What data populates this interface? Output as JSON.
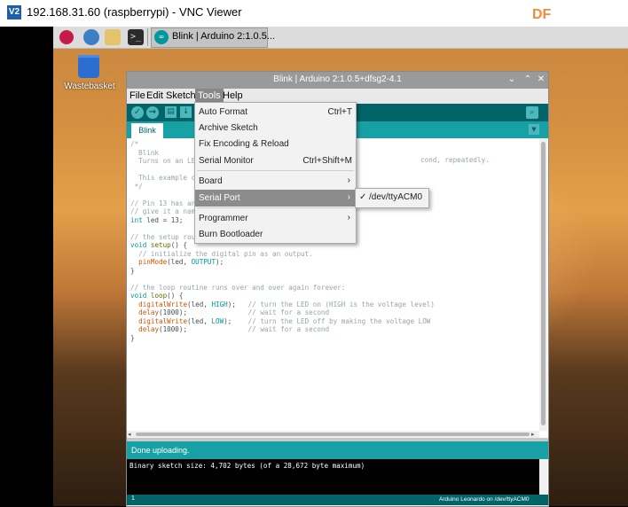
{
  "vnc": {
    "logo_text": "V2",
    "title": "192.168.31.60 (raspberrypi) - VNC Viewer",
    "watermark": "DF"
  },
  "taskbar": {
    "terminal_glyph": ">_",
    "task_label": "Blink | Arduino 2:1.0.5..."
  },
  "desktop": {
    "wastebasket_label": "Wastebasket"
  },
  "arduino": {
    "title": "Blink | Arduino 2:1.0.5+dfsg2-4.1",
    "controls": {
      "minimize": "⌄",
      "maximize": "⌃",
      "close": "✕"
    },
    "menu": {
      "file": "File",
      "edit": "Edit",
      "sketch": "Sketch",
      "tools": "Tools",
      "help": "Help"
    },
    "tab": "Blink",
    "status": "Done uploading.",
    "console": "Binary sketch size: 4,702 bytes (of a 28,672 byte maximum)",
    "footer_line": "1",
    "footer_board": "Arduino Leonardo on /dev/ttyACM0"
  },
  "tools_menu": {
    "items": [
      {
        "label": "Auto Format",
        "shortcut": "Ctrl+T"
      },
      {
        "label": "Archive Sketch",
        "shortcut": ""
      },
      {
        "label": "Fix Encoding & Reload",
        "shortcut": ""
      },
      {
        "label": "Serial Monitor",
        "shortcut": "Ctrl+Shift+M"
      },
      {
        "label": "Board",
        "submenu": true
      },
      {
        "label": "Serial Port",
        "submenu": true,
        "highlighted": true
      },
      {
        "label": "Programmer",
        "submenu": true
      },
      {
        "label": "Burn Bootloader",
        "shortcut": ""
      }
    ]
  },
  "serial_port_submenu": {
    "checked": true,
    "label": "/dev/ttyACM0"
  },
  "code": {
    "lines": [
      "/*",
      "  Blink",
      "  Turns on an LE",
      "",
      "  This example c",
      " */",
      "",
      "// Pin 13 has an",
      "// give it a nam",
      "int led = 13;",
      "",
      "// the setup rou",
      "void setup() {",
      "  // initialize the digital pin as an output.",
      "  pinMode(led, OUTPUT);",
      "}",
      "",
      "// the loop routine runs over and over again forever:",
      "void loop() {",
      "  digitalWrite(led, HIGH);   // turn the LED on (HIGH is the voltage level)",
      "  delay(1000);               // wait for a second",
      "  digitalWrite(led, LOW);    // turn the LED off by making the voltage LOW",
      "  delay(1000);               // wait for a second",
      "}"
    ],
    "trailing_fragment": "cond, repeatedly."
  },
  "colors": {
    "arduino_teal": "#00979c",
    "arduino_dark_teal": "#006468",
    "tools_highlight": "#888888"
  }
}
